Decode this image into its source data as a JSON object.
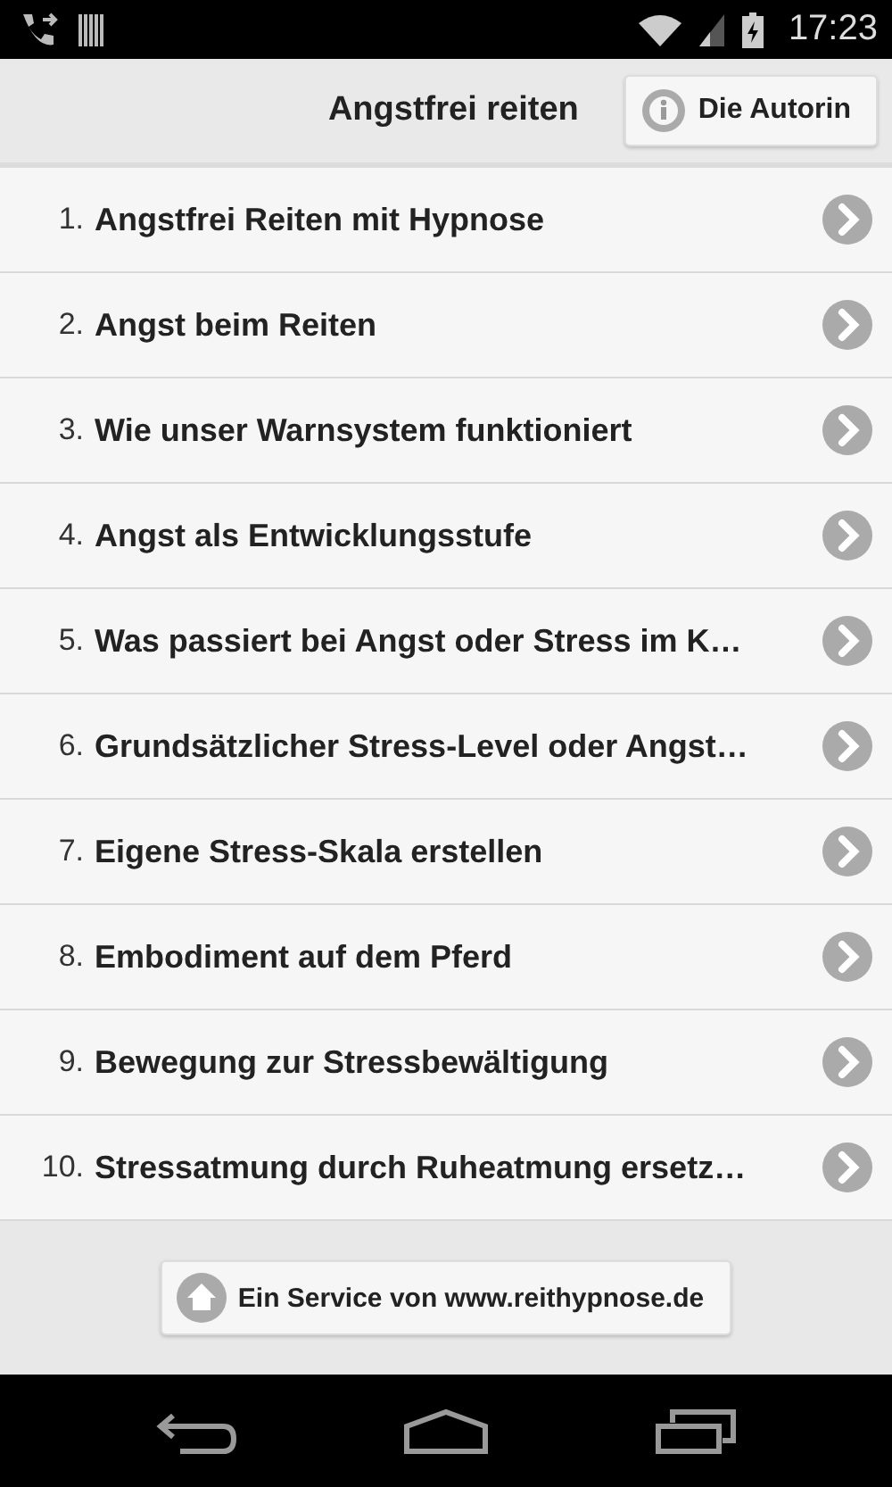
{
  "status_bar": {
    "time": "17:23"
  },
  "header": {
    "title": "Angstfrei reiten",
    "author_button": "Die Autorin"
  },
  "items": [
    {
      "number": "1.",
      "title": "Angstfrei Reiten mit Hypnose"
    },
    {
      "number": "2.",
      "title": "Angst beim Reiten"
    },
    {
      "number": "3.",
      "title": "Wie unser Warnsystem funktioniert"
    },
    {
      "number": "4.",
      "title": "Angst als Entwicklungsstufe"
    },
    {
      "number": "5.",
      "title": "Was passiert bei Angst oder Stress im K…"
    },
    {
      "number": "6.",
      "title": "Grundsätzlicher Stress-Level oder Angst…"
    },
    {
      "number": "7.",
      "title": "Eigene Stress-Skala erstellen"
    },
    {
      "number": "8.",
      "title": "Embodiment auf dem Pferd"
    },
    {
      "number": "9.",
      "title": "Bewegung zur Stressbewältigung"
    },
    {
      "number": "10.",
      "title": "Stressatmung durch Ruheatmung ersetz…"
    }
  ],
  "footer": {
    "service_button": "Ein Service von www.reithypnose.de"
  }
}
